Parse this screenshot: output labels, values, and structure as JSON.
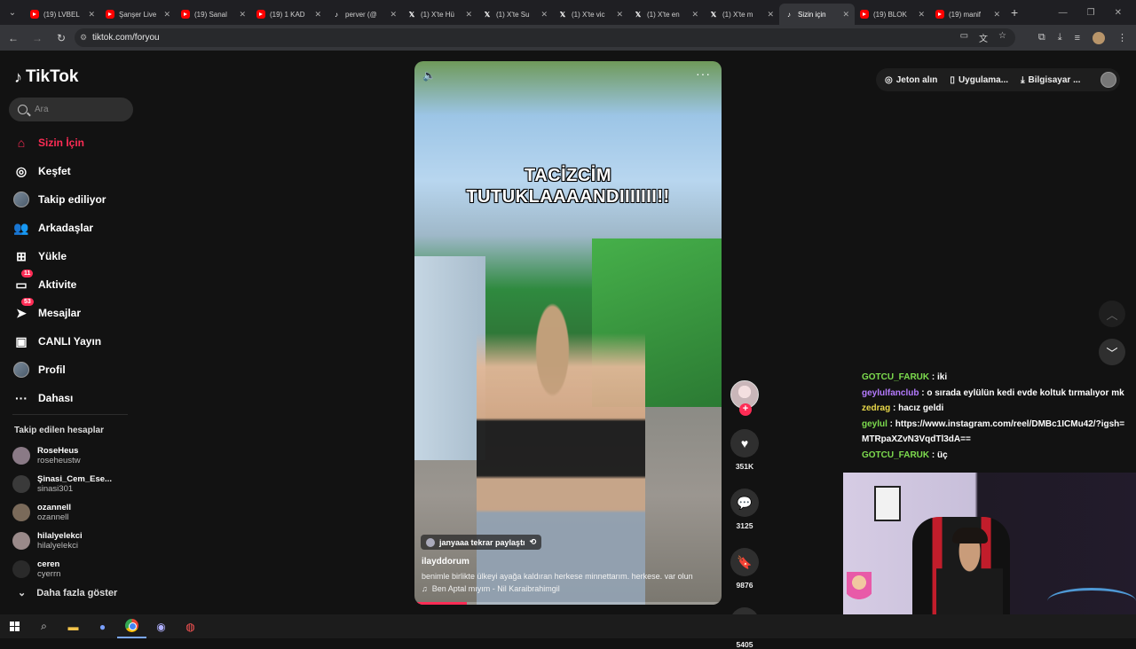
{
  "tabs": [
    {
      "icon": "youtube-icon",
      "title": "(19) LVBEL",
      "active": false
    },
    {
      "icon": "youtube-icon",
      "title": "Şanşer Live",
      "active": false
    },
    {
      "icon": "youtube-icon",
      "title": "(19) Sanal",
      "active": false
    },
    {
      "icon": "youtube-icon",
      "title": "(19) 1 KAD",
      "active": false
    },
    {
      "icon": "tiktok-icon",
      "title": "perver (@",
      "active": false
    },
    {
      "icon": "x-icon",
      "title": "(1) X'te Hü",
      "active": false
    },
    {
      "icon": "x-icon",
      "title": "(1) X'te Su",
      "active": false
    },
    {
      "icon": "x-icon",
      "title": "(1) X'te vic",
      "active": false
    },
    {
      "icon": "x-icon",
      "title": "(1) X'te en",
      "active": false
    },
    {
      "icon": "x-icon",
      "title": "(1) X'te m",
      "active": false
    },
    {
      "icon": "tiktok-icon",
      "title": "Sizin için",
      "active": true
    },
    {
      "icon": "youtube-icon",
      "title": "(19) BLOK",
      "active": false
    },
    {
      "icon": "youtube-icon",
      "title": "(19) manif",
      "active": false
    }
  ],
  "address": {
    "url": "tiktok.com/foryou"
  },
  "brand": {
    "name": "TikTok"
  },
  "search": {
    "placeholder": "Ara"
  },
  "nav": {
    "items": [
      {
        "label": "Sizin İçin",
        "icon": "home-icon",
        "active": true
      },
      {
        "label": "Keşfet",
        "icon": "compass-icon"
      },
      {
        "label": "Takip ediliyor",
        "icon": "avatar"
      },
      {
        "label": "Arkadaşlar",
        "icon": "friends-icon"
      },
      {
        "label": "Yükle",
        "icon": "upload-icon"
      },
      {
        "label": "Aktivite",
        "icon": "activity-icon",
        "badge": "11"
      },
      {
        "label": "Mesajlar",
        "icon": "messages-icon",
        "badge": "53"
      },
      {
        "label": "CANLI Yayın",
        "icon": "live-icon"
      },
      {
        "label": "Profil",
        "icon": "avatar"
      },
      {
        "label": "Dahası",
        "icon": "more-icon"
      }
    ]
  },
  "following": {
    "title": "Takip edilen hesaplar",
    "accounts": [
      {
        "name": "RoseHeus",
        "username": "roseheustw",
        "color": "#8a7a86"
      },
      {
        "name": "Şinasi_Cem_Ese...",
        "username": "sinasi301",
        "color": "#3a3a3a"
      },
      {
        "name": "ozannell",
        "username": "ozannell",
        "color": "#7a6a5a"
      },
      {
        "name": "hilalyelekci",
        "username": "hilalyelekci",
        "color": "#9a8a8a"
      },
      {
        "name": "ceren",
        "username": "cyerrn",
        "color": "#2a2a2a"
      }
    ],
    "show_more": "Daha fazla göster"
  },
  "topbar": {
    "coins": "Jeton alın",
    "app": "Uygulama...",
    "desktop": "Bilgisayar ..."
  },
  "video": {
    "caption_line1": "TACİZCİM",
    "caption_line2": "TUTUKLAAAANDIIIIIII!!",
    "repost": "janyaaa tekrar paylaştı",
    "author": "ilayddorum",
    "description": "benimle birlikte ülkeyi ayağa kaldıran herkese minnettarım. herkese. var olun",
    "music": "Ben Aptal mıyım - Nil Karaibrahimgil",
    "progress": 0.17
  },
  "actions": {
    "likes": "351K",
    "comments": "3125",
    "saves": "9876",
    "shares": "5405"
  },
  "chat": {
    "messages": [
      {
        "user": "GOTCU_FARUK",
        "color": "#7ddc4e",
        "text": "iki"
      },
      {
        "user": "geylulfanclub",
        "color": "#b57bff",
        "text": "o sırada eylülün kedi evde koltuk tırmalıyor mk"
      },
      {
        "user": "zedrag",
        "color": "#e8d84a",
        "text": "hacız geldi"
      },
      {
        "user": "geylul",
        "color": "#7ddc4e",
        "text": "https://www.instagram.com/reel/DMBc1ICMu42/?igsh=MTRpaXZvN3VqdTl3dA=="
      },
      {
        "user": "GOTCU_FARUK",
        "color": "#7ddc4e",
        "text": "üç"
      }
    ]
  }
}
